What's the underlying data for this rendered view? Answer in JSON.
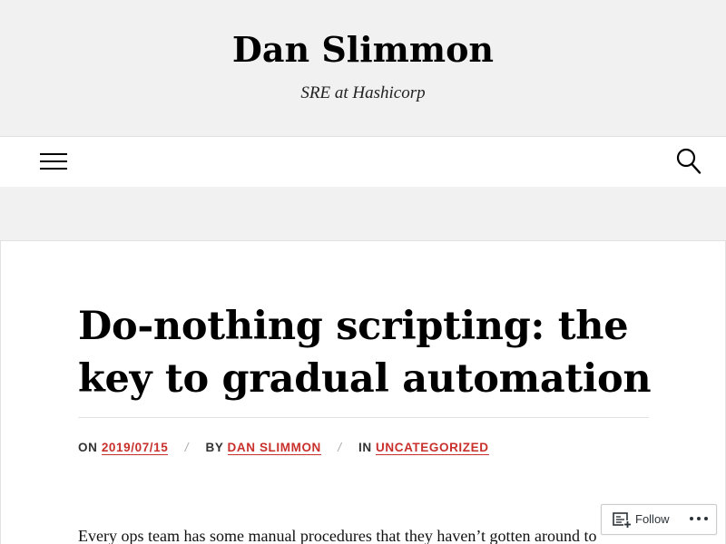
{
  "site": {
    "title": "Dan Slimmon",
    "description": "SRE at Hashicorp"
  },
  "nav": {
    "menu_icon": "hamburger-menu-icon",
    "search_icon": "search-icon"
  },
  "post": {
    "title": "Do-nothing scripting: the key to gradual automation",
    "meta": {
      "on_label": "ON",
      "date": "2019/07/15",
      "by_label": "BY",
      "author": "DAN SLIMMON",
      "in_label": "IN",
      "category": "UNCATEGORIZED",
      "separator": "/"
    },
    "excerpt": "Every ops team has some manual procedures that they haven’t gotten around to"
  },
  "follow": {
    "label": "Follow",
    "icon": "follow-reader-icon",
    "more_icon": "more-options-icon"
  },
  "colors": {
    "accent": "#c9302c",
    "background": "#f1f1f1",
    "content_background": "#ffffff"
  }
}
